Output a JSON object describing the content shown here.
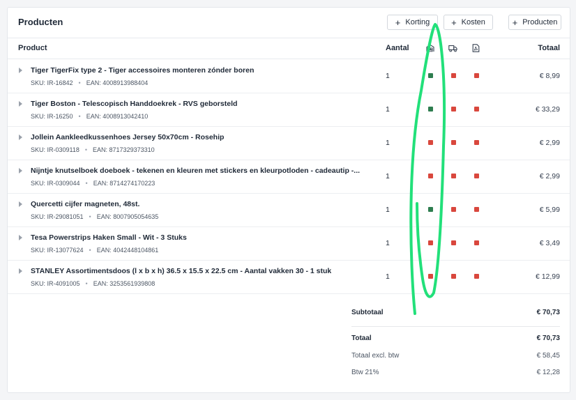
{
  "header": {
    "title": "Producten",
    "buttons": [
      {
        "label": "Korting"
      },
      {
        "label": "Kosten"
      },
      {
        "label": "Producten"
      }
    ]
  },
  "columns": {
    "product": "Product",
    "aantal": "Aantal",
    "totaal": "Totaal",
    "icons": [
      "warehouse-icon",
      "truck-icon",
      "pdf-document-icon"
    ]
  },
  "colors": {
    "status_green": "#2e7d4f",
    "status_red": "#d9473d",
    "annotation": "#22e07a"
  },
  "rows": [
    {
      "name": "Tiger TigerFix type 2 - Tiger accessoires monteren zónder boren",
      "sku": "SKU: IR-16842",
      "ean": "EAN: 4008913988404",
      "qty": "1",
      "price": "€ 8,99",
      "status": [
        "green",
        "red",
        "red"
      ]
    },
    {
      "name": "Tiger Boston - Telescopisch Handdoekrek - RVS geborsteld",
      "sku": "SKU: IR-16250",
      "ean": "EAN: 4008913042410",
      "qty": "1",
      "price": "€ 33,29",
      "status": [
        "green",
        "red",
        "red"
      ]
    },
    {
      "name": "Jollein Aankleedkussenhoes Jersey 50x70cm - Rosehip",
      "sku": "SKU: IR-0309118",
      "ean": "EAN: 8717329373310",
      "qty": "1",
      "price": "€ 2,99",
      "status": [
        "red",
        "red",
        "red"
      ]
    },
    {
      "name": "Nijntje knutselboek doeboek - tekenen en kleuren met stickers en kleurpotloden - cadeautip -...",
      "sku": "SKU: IR-0309044",
      "ean": "EAN: 8714274170223",
      "qty": "1",
      "price": "€ 2,99",
      "status": [
        "red",
        "red",
        "red"
      ]
    },
    {
      "name": "Quercetti cijfer magneten, 48st.",
      "sku": "SKU: IR-29081051",
      "ean": "EAN: 8007905054635",
      "qty": "1",
      "price": "€ 5,99",
      "status": [
        "green",
        "red",
        "red"
      ]
    },
    {
      "name": "Tesa Powerstrips Haken Small - Wit - 3 Stuks",
      "sku": "SKU: IR-13077624",
      "ean": "EAN: 4042448104861",
      "qty": "1",
      "price": "€ 3,49",
      "status": [
        "red",
        "red",
        "red"
      ]
    },
    {
      "name": "STANLEY Assortimentsdoos (l x b x h) 36.5 x 15.5 x 22.5 cm - Aantal vakken 30 - 1 stuk",
      "sku": "SKU: IR-4091005",
      "ean": "EAN: 3253561939808",
      "qty": "1",
      "price": "€ 12,99",
      "status": [
        "red",
        "red",
        "red"
      ]
    }
  ],
  "totals": {
    "subtotaal_label": "Subtotaal",
    "subtotaal_value": "€ 70,73",
    "totaal_label": "Totaal",
    "totaal_value": "€ 70,73",
    "excl_label": "Totaal excl. btw",
    "excl_value": "€ 58,45",
    "btw_label": "Btw 21%",
    "btw_value": "€ 12,28"
  }
}
